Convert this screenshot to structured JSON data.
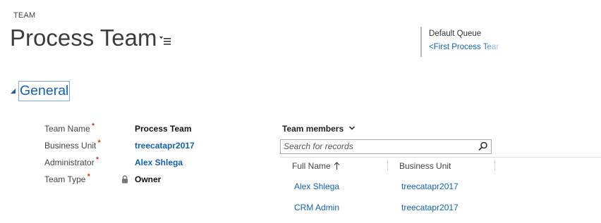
{
  "header": {
    "entity_label": "TEAM",
    "record_title": "Process Team"
  },
  "header_field": {
    "label": "Default Queue",
    "value": "<First Process Tear"
  },
  "section": {
    "title": "General"
  },
  "fields": {
    "team_name": {
      "label": "Team Name",
      "required": "*",
      "value": "Process Team"
    },
    "business_unit": {
      "label": "Business Unit",
      "required": "*",
      "value": "treecatapr2017"
    },
    "administrator": {
      "label": "Administrator",
      "required": "*",
      "value": "Alex Shlega"
    },
    "team_type": {
      "label": "Team Type",
      "required": "*",
      "value": "Owner"
    }
  },
  "subgrid": {
    "title": "Team members",
    "search_placeholder": "Search for records",
    "columns": [
      "Full Name",
      "Business Unit"
    ],
    "rows": [
      {
        "full_name": "Alex Shlega",
        "business_unit": "treecatapr2017"
      },
      {
        "full_name": "CRM Admin",
        "business_unit": "treecatapr2017"
      }
    ]
  },
  "icons": {
    "form_selector": "form-selector-icon",
    "section_toggle": "collapse-triangle-icon",
    "lock": "lock-icon",
    "subgrid_view": "chevron-down-icon",
    "search": "search-icon",
    "sort": "sort-ascending-icon"
  },
  "colors": {
    "link": "#1160b7",
    "required": "#cc0000",
    "title": "#3c3c3c"
  }
}
